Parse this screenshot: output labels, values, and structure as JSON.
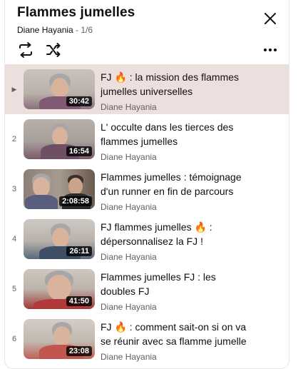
{
  "header": {
    "title": "Flammes jumelles",
    "channel": "Diane Hayania",
    "position": " - 1/6"
  },
  "icons": {
    "close": "close-icon",
    "loop": "loop-icon",
    "shuffle": "shuffle-icon",
    "more": "more-vertical-icon",
    "fire": "fire-emoji"
  },
  "videos": [
    {
      "index": "▶",
      "title": "FJ 🔥 : la mission des flammes jumelles universelles",
      "duration": "30:42",
      "channel": "Diane Hayania"
    },
    {
      "index": "2",
      "title": "L' occulte dans les tierces des flammes jumelles",
      "duration": "16:54",
      "channel": "Diane Hayania"
    },
    {
      "index": "3",
      "title": "Flammes jumelles : témoignage d'un runner en fin de parcours",
      "duration": "2:08:58",
      "channel": "Diane Hayania"
    },
    {
      "index": "4",
      "title": "FJ flammes jumelles 🔥 : dépersonnalisez la FJ !",
      "duration": "26:11",
      "channel": "Diane Hayania"
    },
    {
      "index": "5",
      "title": "Flammes jumelles FJ : les doubles FJ",
      "duration": "41:50",
      "channel": "Diane Hayania"
    },
    {
      "index": "6",
      "title": "FJ 🔥 : comment sait-on si on va se réunir avec sa flamme jumelle",
      "duration": "23:08",
      "channel": "Diane Hayania"
    }
  ],
  "colors": {
    "active_row": "#eedfdf",
    "secondary_text": "#606060"
  }
}
